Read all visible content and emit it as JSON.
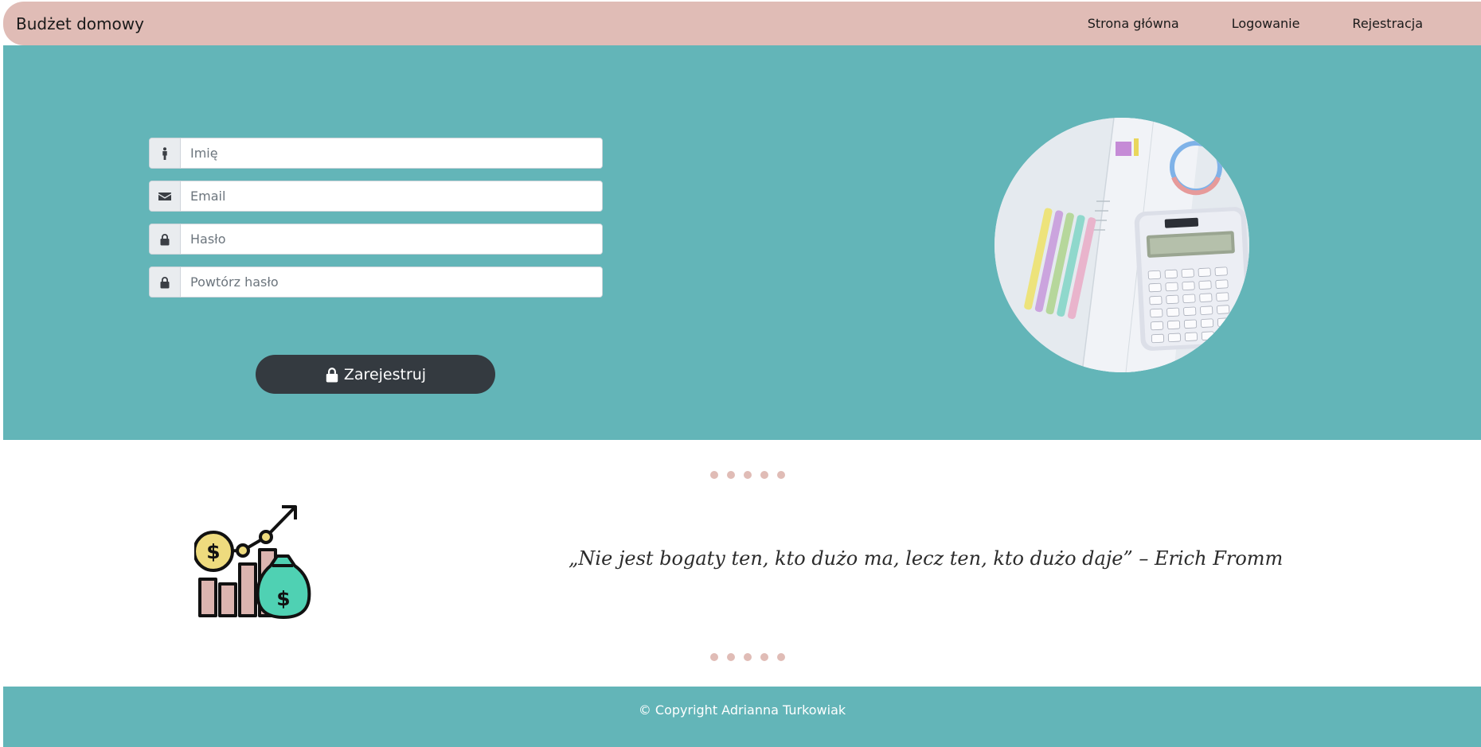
{
  "navbar": {
    "brand": "Budżet domowy",
    "links": [
      "Strona główna",
      "Logowanie",
      "Rejestracja"
    ]
  },
  "form": {
    "fields": [
      {
        "placeholder": "Imię",
        "icon": "person-icon"
      },
      {
        "placeholder": "Email",
        "icon": "envelope-icon"
      },
      {
        "placeholder": "Hasło",
        "icon": "lock-icon"
      },
      {
        "placeholder": "Powtórz hasło",
        "icon": "lock-icon"
      }
    ],
    "submit_label": "Zarejestruj"
  },
  "quote": {
    "text": "„Nie jest bogaty ten, kto dużo ma, lecz ten, kto dużo daje” – Erich Fromm"
  },
  "footer": {
    "copyright": "© Copyright Adrianna Turkowiak"
  },
  "colors": {
    "accent": "#63b5b8",
    "nav": "#e0bcb6",
    "button": "#343a40"
  }
}
